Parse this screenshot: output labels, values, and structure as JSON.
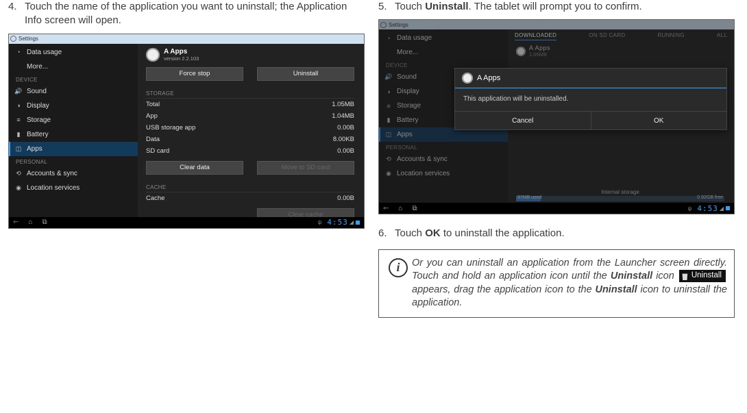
{
  "step4": {
    "num": "4.",
    "text": "Touch the name of the application you want to uninstall; the Application Info screen will open."
  },
  "step5": {
    "num": "5.",
    "pre": "Touch ",
    "bold": "Uninstall",
    "post": ". The tablet will prompt you to confirm."
  },
  "step6": {
    "num": "6.",
    "pre": "Touch ",
    "bold": "OK",
    "post": " to uninstall the application."
  },
  "shotA": {
    "title": "Settings",
    "sidebar": {
      "wireless_items": [
        {
          "icon": "◔",
          "label": "Data usage"
        },
        {
          "icon": "",
          "label": "More..."
        }
      ],
      "device_header": "DEVICE",
      "device_items": [
        {
          "icon": "🔊",
          "label": "Sound"
        },
        {
          "icon": "◑",
          "label": "Display"
        },
        {
          "icon": "≡",
          "label": "Storage"
        },
        {
          "icon": "▮",
          "label": "Battery"
        },
        {
          "icon": "◫",
          "label": "Apps",
          "sel": true
        }
      ],
      "personal_header": "PERSONAL",
      "personal_items": [
        {
          "icon": "⟲",
          "label": "Accounts & sync"
        },
        {
          "icon": "◉",
          "label": "Location services"
        }
      ]
    },
    "app": {
      "name": "A Apps",
      "ver": "version 2.2.103",
      "btn_force": "Force stop",
      "btn_uninst": "Uninstall",
      "storage_hdr": "STORAGE",
      "rows": [
        {
          "k": "Total",
          "v": "1.05MB"
        },
        {
          "k": "App",
          "v": "1.04MB"
        },
        {
          "k": "USB storage app",
          "v": "0.00B"
        },
        {
          "k": "Data",
          "v": "8.00KB"
        },
        {
          "k": "SD card",
          "v": "0.00B"
        }
      ],
      "btn_clear": "Clear data",
      "btn_move": "Move to SD card",
      "cache_hdr": "CACHE",
      "cache_row": {
        "k": "Cache",
        "v": "0.00B"
      },
      "btn_ccache": "Clear cache"
    },
    "clock": "4:53"
  },
  "shotB": {
    "title": "Settings",
    "tabs": [
      "DOWNLOADED",
      "ON SD CARD",
      "RUNNING",
      "ALL"
    ],
    "mini": {
      "name": "A Apps",
      "size": "1.05MB"
    },
    "dialog": {
      "title": "A Apps",
      "msg": "This application will be uninstalled.",
      "cancel": "Cancel",
      "ok": "OK"
    },
    "storage": {
      "label": "Internal storage",
      "used": "97MB used",
      "free": "0.92GB free"
    },
    "clock": "4:53"
  },
  "tip": {
    "p1": "Or you can uninstall an application from the Launcher screen directly. Touch and hold an application icon until the ",
    "b1": "Uninstall",
    "p2": " icon ",
    "chip": "Uninstall",
    "p3": " appears, drag the application icon to the ",
    "b2": "Uninstall",
    "p4": " icon to uninstall the application."
  }
}
